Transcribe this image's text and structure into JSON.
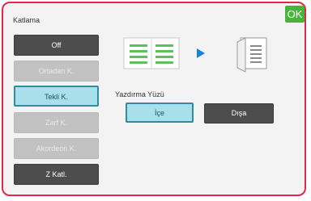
{
  "title": "Katlama",
  "ok_label": "OK",
  "fold_options": [
    {
      "label": "Off",
      "state": "normal"
    },
    {
      "label": "Ortadan K.",
      "state": "disabled"
    },
    {
      "label": "Tekli K.",
      "state": "selected"
    },
    {
      "label": "Zarf K.",
      "state": "disabled"
    },
    {
      "label": "Akordeon K.",
      "state": "disabled"
    },
    {
      "label": "Z Katl.",
      "state": "normal"
    }
  ],
  "print_side": {
    "label": "Yazdırma Yüzü",
    "inside_label": "İçe",
    "outside_label": "Dışa",
    "selected": "İçe"
  },
  "preview_icons": [
    "open-book-icon",
    "play-arrow-icon",
    "folded-sheet-icon"
  ],
  "colors": {
    "border_accent": "#e3264b",
    "ok_green": "#46b53a",
    "selected_fill": "#a8dfeb",
    "selected_border": "#2e8ba2",
    "arrow_blue": "#1e7fd6",
    "icon_green": "#5cc05c"
  }
}
